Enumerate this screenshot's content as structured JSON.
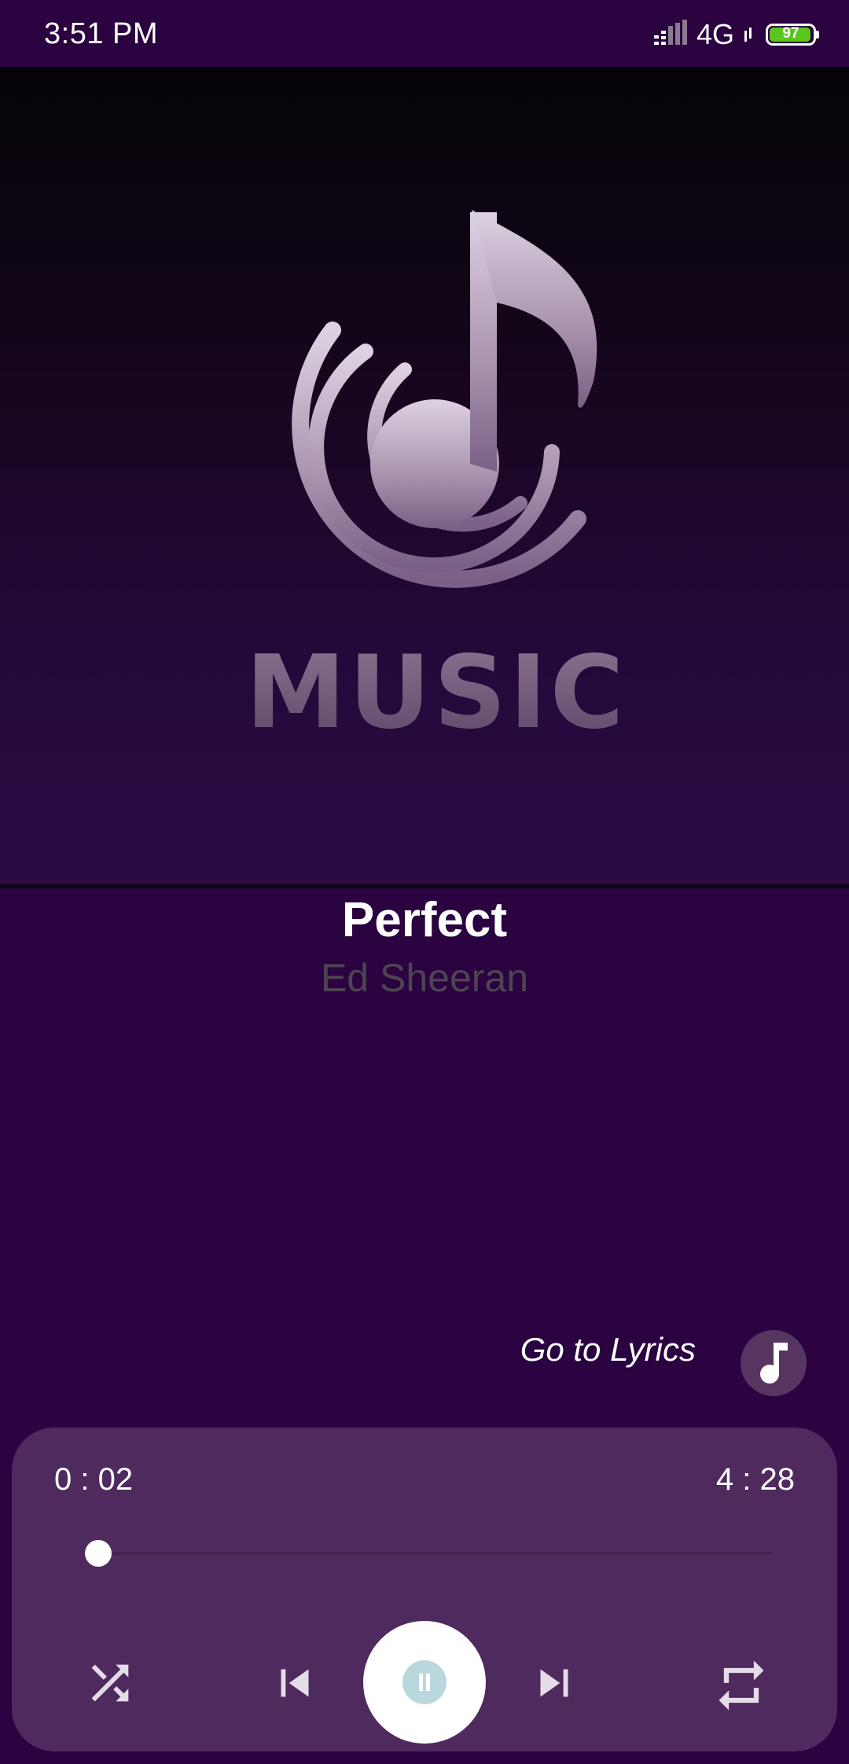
{
  "status_bar": {
    "time": "3:51 PM",
    "network": "4G",
    "battery": "97",
    "battery_level": 0.97,
    "signal_icon": "signal-icon",
    "colors": {
      "battery": "#5bc61e"
    }
  },
  "album": {
    "art_text": "MUSIC",
    "icon": "music-logo"
  },
  "track": {
    "title": "Perfect",
    "artist": "Ed Sheeran"
  },
  "lyrics": {
    "label": "Go to Lyrics",
    "icon": "music-note-icon"
  },
  "player": {
    "elapsed": "0 : 02",
    "total": "4 : 28",
    "progress": 0.008,
    "controls": [
      "shuffle-icon",
      "previous-icon",
      "pause-icon",
      "next-icon",
      "repeat-icon"
    ]
  },
  "colors": {
    "background": "#2a0340",
    "panel": "#4f2a5e",
    "artist_text": "#4e4452",
    "accent": "#ffffff"
  }
}
